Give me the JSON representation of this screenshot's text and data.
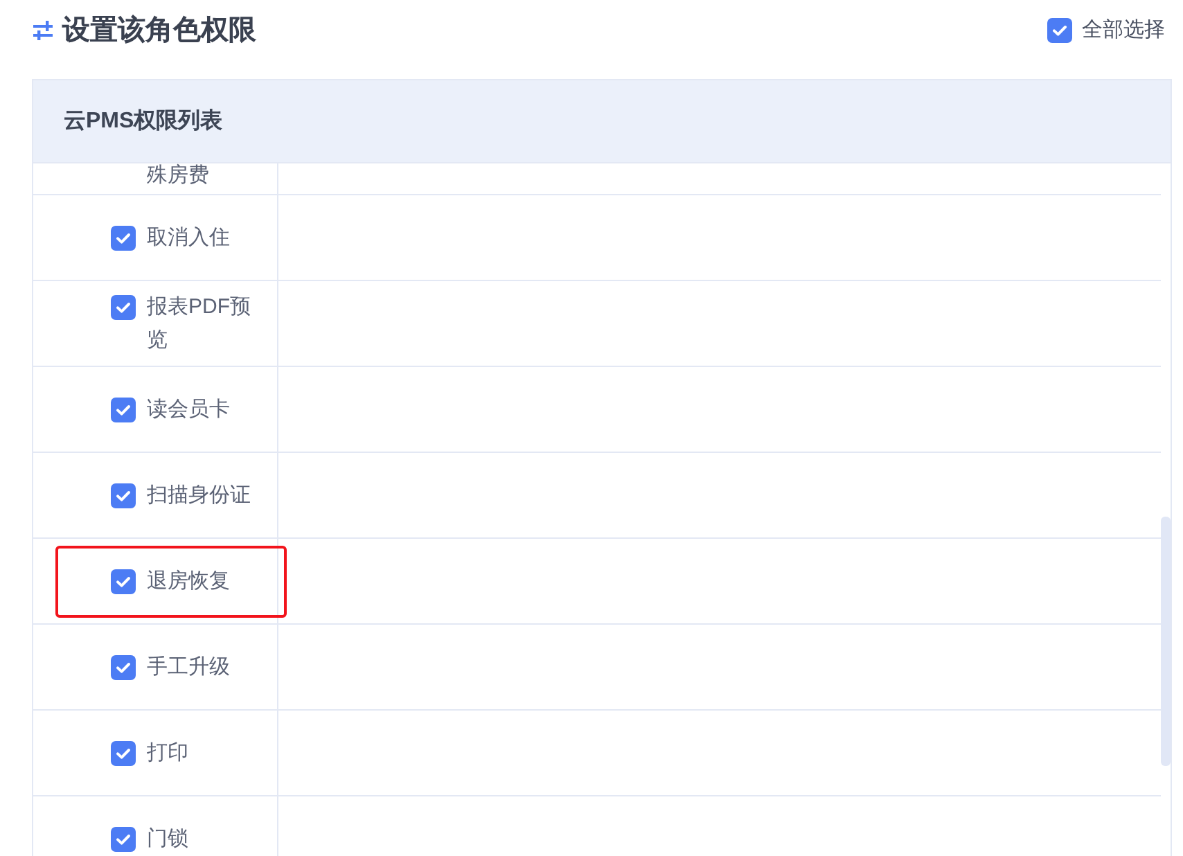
{
  "header": {
    "title": "设置该角色权限",
    "select_all": {
      "label": "全部选择",
      "checked": true
    }
  },
  "table": {
    "title": "云PMS权限列表",
    "rows": [
      {
        "kind": "partial",
        "label": "殊房费"
      },
      {
        "kind": "checkbox",
        "label": "取消入住",
        "checked": true,
        "highlighted": false
      },
      {
        "kind": "checkbox",
        "label": "报表PDF预览",
        "checked": true,
        "highlighted": false
      },
      {
        "kind": "checkbox",
        "label": "读会员卡",
        "checked": true,
        "highlighted": false
      },
      {
        "kind": "checkbox",
        "label": "扫描身份证",
        "checked": true,
        "highlighted": false
      },
      {
        "kind": "checkbox",
        "label": "退房恢复",
        "checked": true,
        "highlighted": true
      },
      {
        "kind": "checkbox",
        "label": "手工升级",
        "checked": true,
        "highlighted": false
      },
      {
        "kind": "checkbox",
        "label": "打印",
        "checked": true,
        "highlighted": false
      },
      {
        "kind": "checkbox",
        "label": "门锁",
        "checked": true,
        "highlighted": false
      }
    ]
  }
}
